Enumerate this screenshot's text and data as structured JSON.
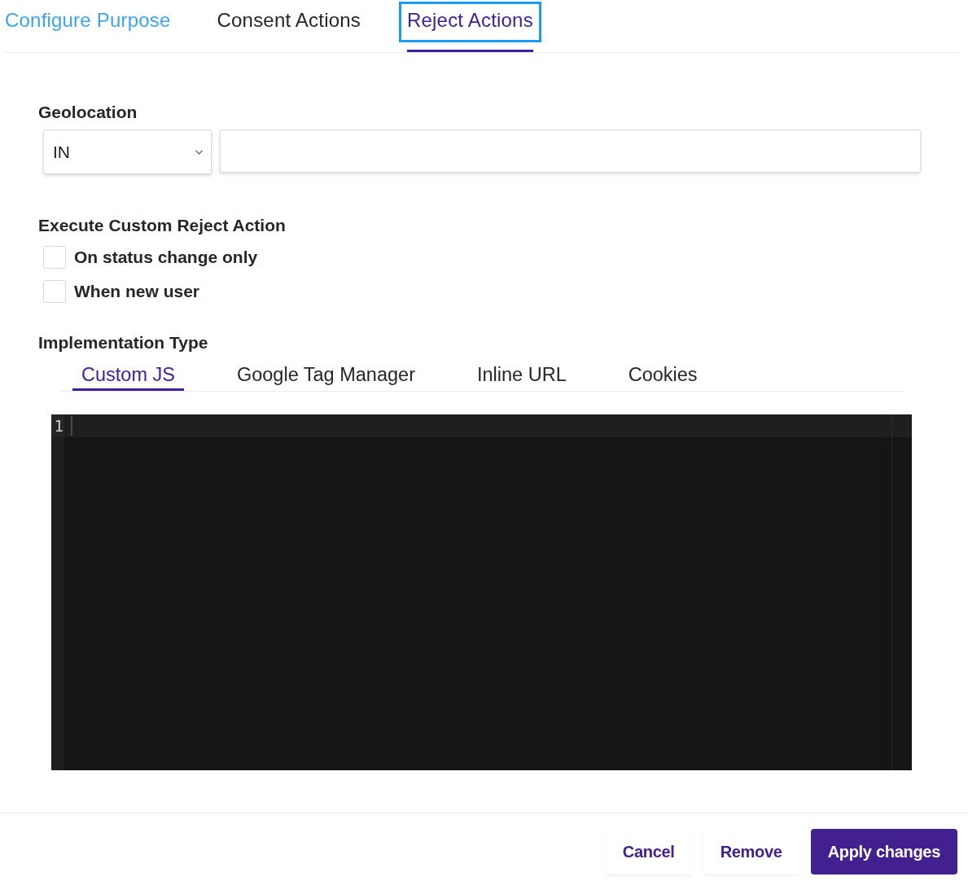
{
  "tabs": [
    {
      "label": "Configure Purpose",
      "selected": false,
      "hovered": true,
      "focused": false
    },
    {
      "label": "Consent Actions",
      "selected": false,
      "hovered": false,
      "focused": false
    },
    {
      "label": "Reject Actions",
      "selected": true,
      "hovered": false,
      "focused": true
    }
  ],
  "geolocation": {
    "label": "Geolocation",
    "region_select": {
      "value": "IN"
    }
  },
  "custom_reject_action": {
    "label": "Execute Custom Reject Action",
    "options": [
      {
        "label": "On status change only",
        "checked": false
      },
      {
        "label": "When new user",
        "checked": false
      }
    ]
  },
  "implementation_type": {
    "label": "Implementation Type",
    "tabs": [
      {
        "label": "Custom JS",
        "selected": true
      },
      {
        "label": "Google Tag Manager",
        "selected": false
      },
      {
        "label": "Inline URL",
        "selected": false
      },
      {
        "label": "Cookies",
        "selected": false
      }
    ]
  },
  "code_editor": {
    "line_numbers": [
      "1"
    ]
  },
  "buttons": [
    {
      "label": "Cancel",
      "kind": "secondary"
    },
    {
      "label": "Remove",
      "kind": "secondary"
    },
    {
      "label": "Apply changes",
      "kind": "primary"
    }
  ]
}
